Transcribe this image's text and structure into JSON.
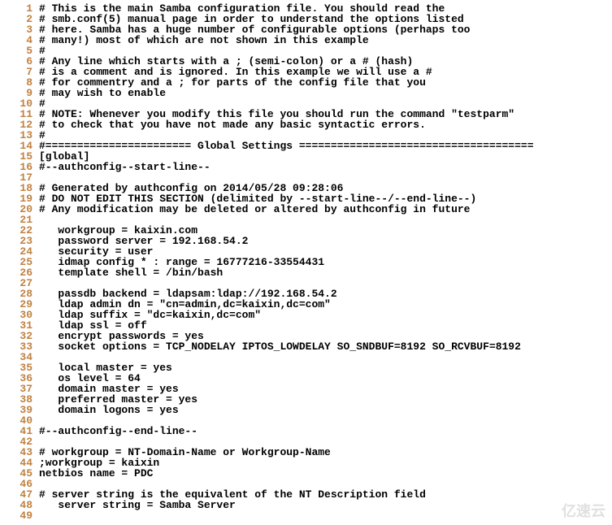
{
  "lines": [
    {
      "num": "1",
      "text": "# This is the main Samba configuration file. You should read the"
    },
    {
      "num": "2",
      "text": "# smb.conf(5) manual page in order to understand the options listed"
    },
    {
      "num": "3",
      "text": "# here. Samba has a huge number of configurable options (perhaps too"
    },
    {
      "num": "4",
      "text": "# many!) most of which are not shown in this example"
    },
    {
      "num": "5",
      "text": "#"
    },
    {
      "num": "6",
      "text": "# Any line which starts with a ; (semi-colon) or a # (hash)"
    },
    {
      "num": "7",
      "text": "# is a comment and is ignored. In this example we will use a #"
    },
    {
      "num": "8",
      "text": "# for commentry and a ; for parts of the config file that you"
    },
    {
      "num": "9",
      "text": "# may wish to enable"
    },
    {
      "num": "10",
      "text": "#"
    },
    {
      "num": "11",
      "text": "# NOTE: Whenever you modify this file you should run the command \"testparm\""
    },
    {
      "num": "12",
      "text": "# to check that you have not made any basic syntactic errors."
    },
    {
      "num": "13",
      "text": "#"
    },
    {
      "num": "14",
      "text": "#======================= Global Settings ====================================="
    },
    {
      "num": "15",
      "text": "[global]"
    },
    {
      "num": "16",
      "text": "#--authconfig--start-line--"
    },
    {
      "num": "17",
      "text": ""
    },
    {
      "num": "18",
      "text": "# Generated by authconfig on 2014/05/28 09:28:06"
    },
    {
      "num": "19",
      "text": "# DO NOT EDIT THIS SECTION (delimited by --start-line--/--end-line--)"
    },
    {
      "num": "20",
      "text": "# Any modification may be deleted or altered by authconfig in future"
    },
    {
      "num": "21",
      "text": ""
    },
    {
      "num": "22",
      "text": "   workgroup = kaixin.com"
    },
    {
      "num": "23",
      "text": "   password server = 192.168.54.2"
    },
    {
      "num": "24",
      "text": "   security = user"
    },
    {
      "num": "25",
      "text": "   idmap config * : range = 16777216-33554431"
    },
    {
      "num": "26",
      "text": "   template shell = /bin/bash"
    },
    {
      "num": "27",
      "text": ""
    },
    {
      "num": "28",
      "text": "   passdb backend = ldapsam:ldap://192.168.54.2"
    },
    {
      "num": "29",
      "text": "   ldap admin dn = \"cn=admin,dc=kaixin,dc=com\""
    },
    {
      "num": "30",
      "text": "   ldap suffix = \"dc=kaixin,dc=com\""
    },
    {
      "num": "31",
      "text": "   ldap ssl = off"
    },
    {
      "num": "32",
      "text": "   encrypt passwords = yes"
    },
    {
      "num": "33",
      "text": "   socket options = TCP_NODELAY IPTOS_LOWDELAY SO_SNDBUF=8192 SO_RCVBUF=8192"
    },
    {
      "num": "34",
      "text": ""
    },
    {
      "num": "35",
      "text": "   local master = yes"
    },
    {
      "num": "36",
      "text": "   os level = 64"
    },
    {
      "num": "37",
      "text": "   domain master = yes"
    },
    {
      "num": "38",
      "text": "   preferred master = yes"
    },
    {
      "num": "39",
      "text": "   domain logons = yes"
    },
    {
      "num": "40",
      "text": ""
    },
    {
      "num": "41",
      "text": "#--authconfig--end-line--"
    },
    {
      "num": "42",
      "text": ""
    },
    {
      "num": "43",
      "text": "# workgroup = NT-Domain-Name or Workgroup-Name"
    },
    {
      "num": "44",
      "text": ";workgroup = kaixin"
    },
    {
      "num": "45",
      "text": "netbios name = PDC"
    },
    {
      "num": "46",
      "text": ""
    },
    {
      "num": "47",
      "text": "# server string is the equivalent of the NT Description field"
    },
    {
      "num": "48",
      "text": "   server string = Samba Server"
    },
    {
      "num": "49",
      "text": ""
    }
  ],
  "watermark": "亿速云"
}
